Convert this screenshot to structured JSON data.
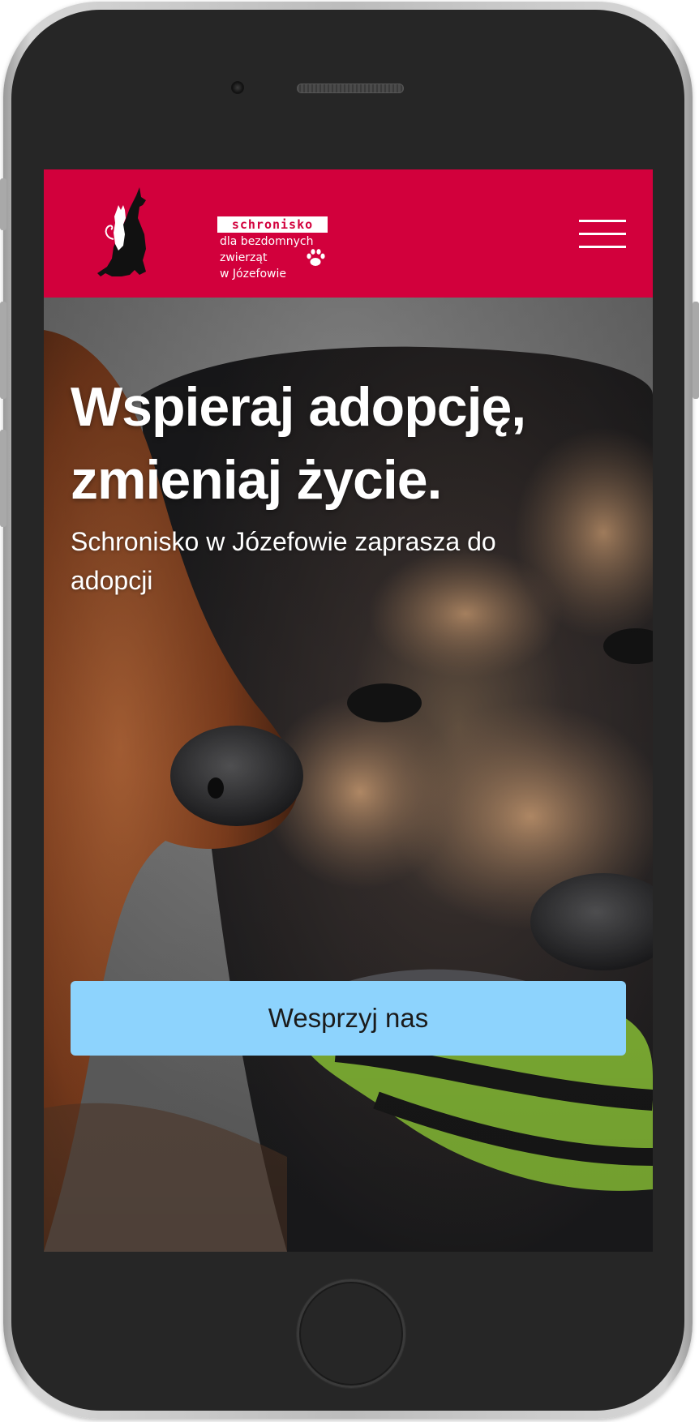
{
  "logo": {
    "tag": "schronisko",
    "line1": "dla bezdomnych",
    "line2": "zwierząt",
    "line3": "w Józefowie"
  },
  "hero": {
    "title_line1": "Wspieraj adopcję,",
    "title_line2": "zmieniaj życie.",
    "subtitle_line1": "Schronisko w Józefowie zaprasza do",
    "subtitle_line2": "adopcji",
    "cta_label": "Wesprzyj nas"
  },
  "colors": {
    "brand": "#d2003c",
    "cta": "#8dd3fd",
    "text_on_brand": "#ffffff"
  },
  "icons": {
    "menu": "hamburger-icon",
    "logo_mark": "dog-cat-silhouette-icon",
    "paw": "paw-icon"
  }
}
